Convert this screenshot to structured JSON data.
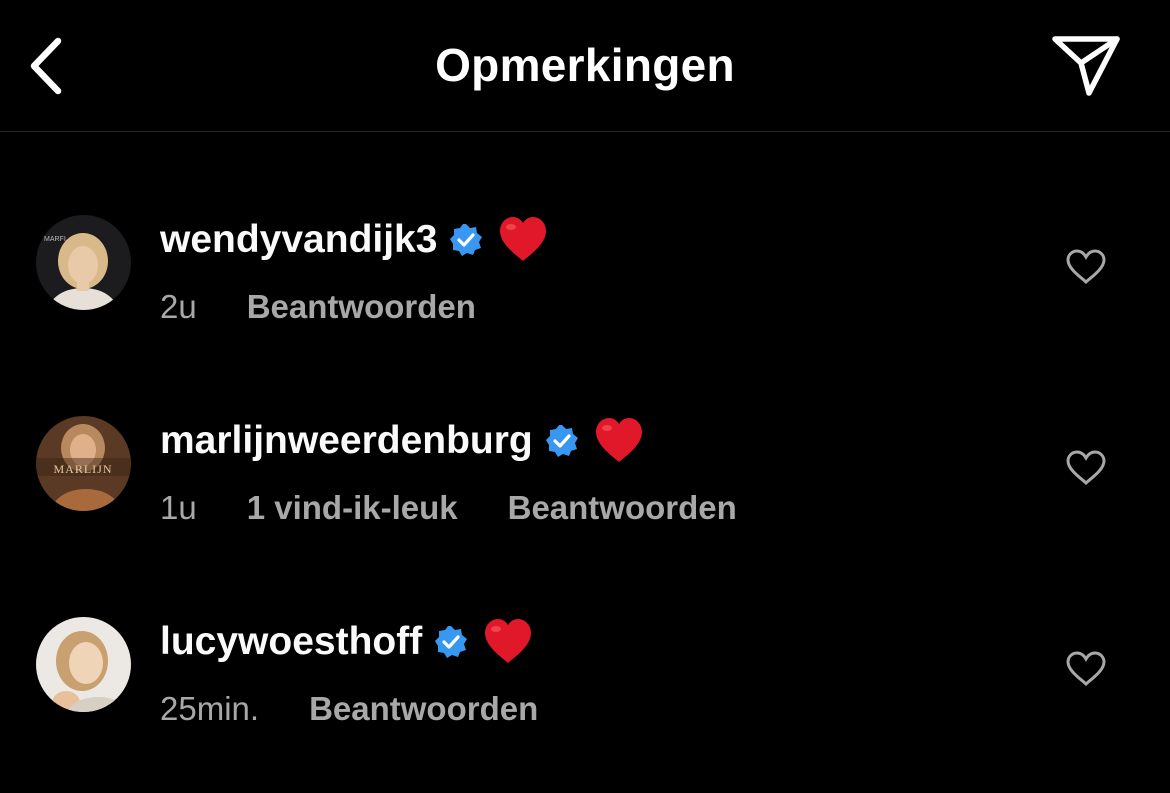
{
  "header": {
    "title": "Opmerkingen",
    "back_icon": "chevron-left-icon",
    "send_icon": "paper-plane-icon"
  },
  "colors": {
    "background": "#000000",
    "text_primary": "#fafafa",
    "text_secondary": "#a8a8a8",
    "verified_blue": "#3897f0",
    "heart_red": "#e0182a",
    "divider": "#262626"
  },
  "comments": [
    {
      "username": "wendyvandijk3",
      "verified": true,
      "text": "❤️",
      "time": "2u",
      "likes": "",
      "reply_label": "Beantwoorden",
      "avatar_logo_text": "MARFI"
    },
    {
      "username": "marlijnweerdenburg",
      "verified": true,
      "text": "❤️",
      "time": "1u",
      "likes": "1 vind-ik-leuk",
      "reply_label": "Beantwoorden",
      "avatar_logo_text": "MARLIJN"
    },
    {
      "username": "lucywoesthoff",
      "verified": true,
      "text": "❤️",
      "time": "25min.",
      "likes": "",
      "reply_label": "Beantwoorden",
      "avatar_logo_text": ""
    }
  ]
}
